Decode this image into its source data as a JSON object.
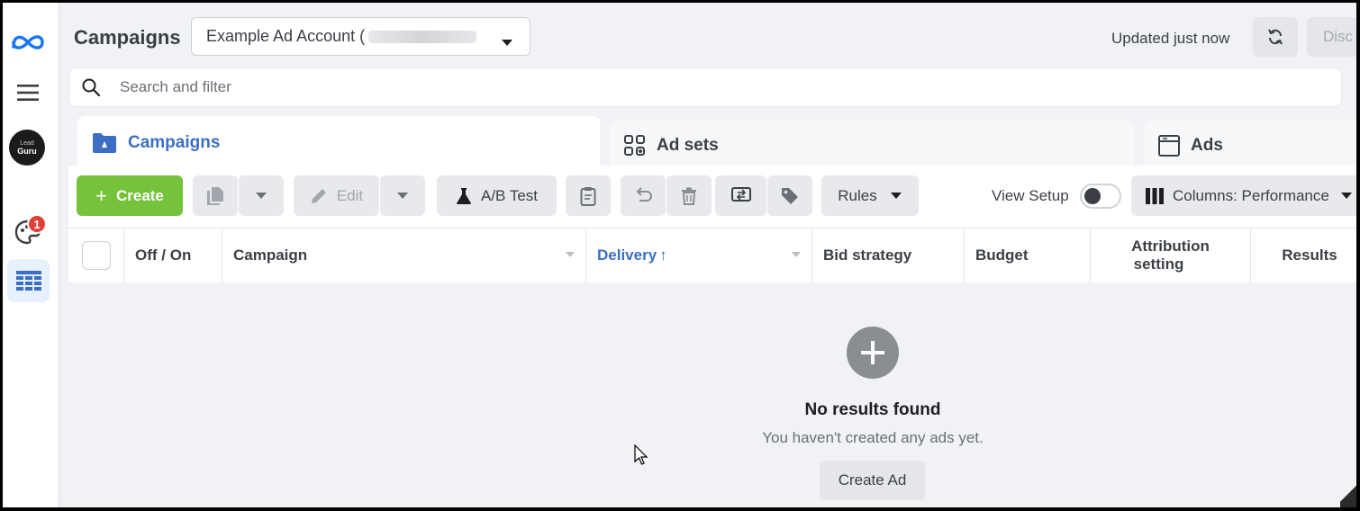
{
  "header": {
    "title": "Campaigns",
    "account_name": "Example Ad Account (",
    "updated": "Updated just now",
    "discard_label": "Disc"
  },
  "rail": {
    "avatar_top": "Lead",
    "avatar_bottom": "Guru",
    "notification_count": "1"
  },
  "search": {
    "placeholder": "Search and filter"
  },
  "tabs": [
    {
      "label": "Campaigns",
      "active": true
    },
    {
      "label": "Ad sets",
      "active": false
    },
    {
      "label": "Ads",
      "active": false
    }
  ],
  "toolbar": {
    "create_label": "Create",
    "edit_label": "Edit",
    "ab_test_label": "A/B Test",
    "rules_label": "Rules",
    "view_setup_label": "View Setup",
    "view_setup_on": false,
    "columns_label": "Columns: Performance"
  },
  "table": {
    "columns": [
      "Off / On",
      "Campaign",
      "Delivery",
      "Bid strategy",
      "Budget",
      "Attribution setting",
      "Results"
    ],
    "sorted_column": "Delivery",
    "sort_direction": "↑",
    "attribution_line1": "Attribution",
    "attribution_line2": "setting"
  },
  "empty_state": {
    "title": "No results found",
    "subtitle": "You haven't created any ads yet.",
    "button_label": "Create Ad"
  },
  "colors": {
    "accent": "#3c6ec5",
    "create_green": "#75c33b",
    "badge_red": "#e0403a",
    "background": "#f0f2f5"
  }
}
